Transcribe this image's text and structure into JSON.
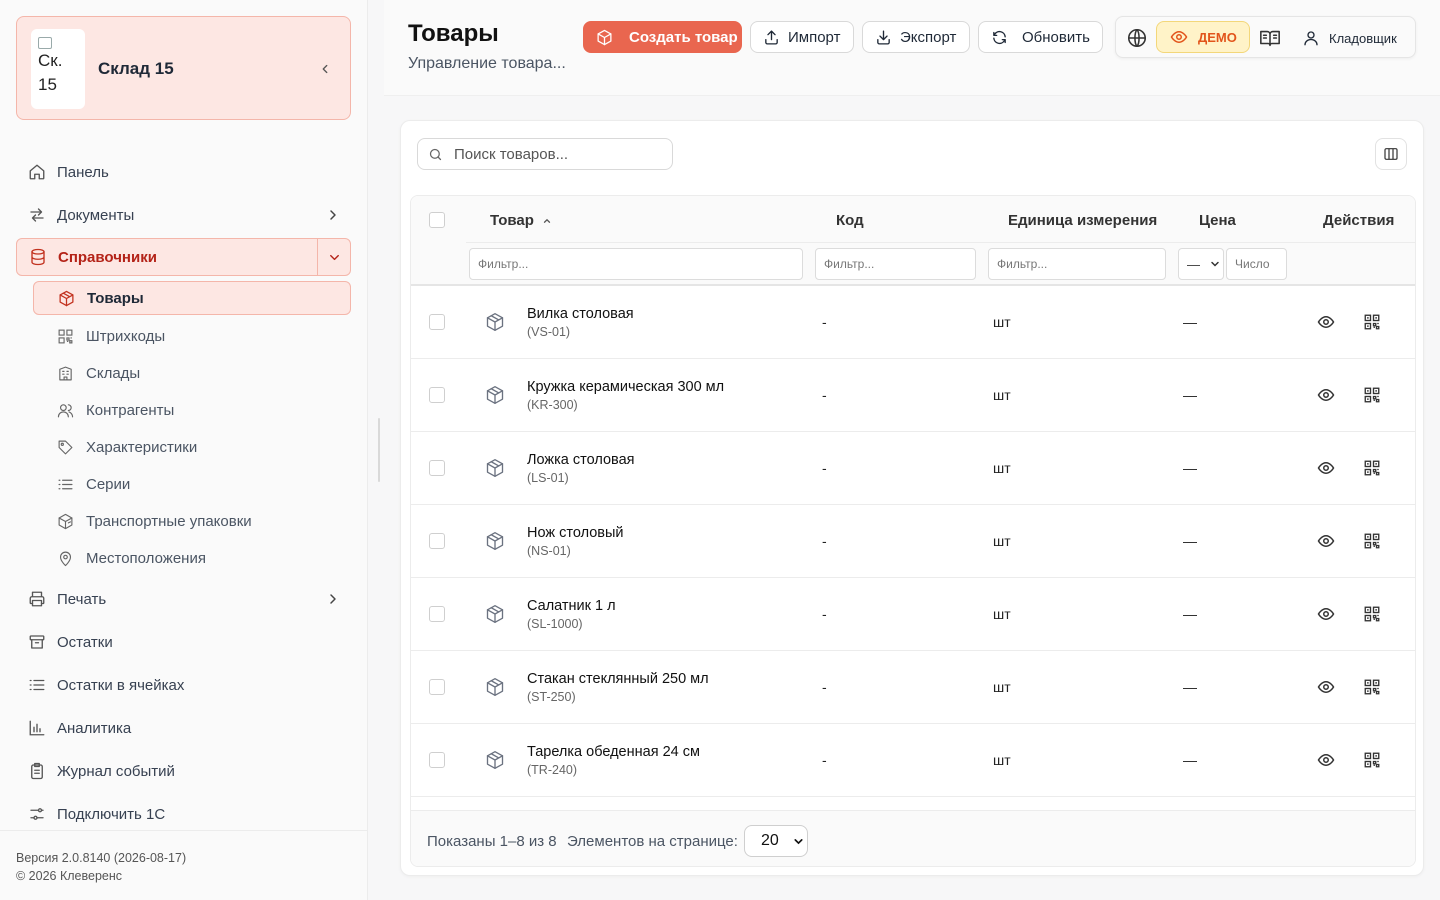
{
  "brand": {
    "logo_line1": "Ск.",
    "logo_line2": "15",
    "title": "Склад 15"
  },
  "nav": {
    "dashboard": "Панель",
    "documents": "Документы",
    "catalogs": "Справочники",
    "catalog_items": {
      "products": "Товары",
      "barcodes": "Штрихкоды",
      "warehouses": "Склады",
      "counterparties": "Контрагенты",
      "characteristics": "Характеристики",
      "series": "Серии",
      "transport_packs": "Транспортные упаковки",
      "locations": "Местоположения"
    },
    "print": "Печать",
    "stock": "Остатки",
    "cell_stock": "Остатки в ячейках",
    "analytics": "Аналитика",
    "event_log": "Журнал событий",
    "connect_1c": "Подключить 1С"
  },
  "footer": {
    "version": "Версия 2.0.8140 (2026-08-17)",
    "copyright": "© 2026 Клеверенс"
  },
  "header": {
    "title": "Товары",
    "subtitle": "Управление товара...",
    "create_label": "Создать товар",
    "import_label": "Импорт",
    "export_label": "Экспорт",
    "refresh_label": "Обновить",
    "demo_label": "ДЕМО",
    "user_label": "Кладовщик"
  },
  "search": {
    "placeholder": "Поиск товаров..."
  },
  "table": {
    "columns": {
      "product": "Товар",
      "code": "Код",
      "unit": "Единица измерения",
      "price": "Цена",
      "actions": "Действия"
    },
    "filters": {
      "product": "Фильтр...",
      "code": "Фильтр...",
      "unit": "Фильтр...",
      "price_op": "—",
      "price_num": "Число"
    },
    "rows": [
      {
        "name": "Вилка столовая",
        "sku": "(VS-01)",
        "code": "-",
        "unit": "шт",
        "price": "—"
      },
      {
        "name": "Кружка керамическая 300 мл",
        "sku": "(KR-300)",
        "code": "-",
        "unit": "шт",
        "price": "—"
      },
      {
        "name": "Ложка столовая",
        "sku": "(LS-01)",
        "code": "-",
        "unit": "шт",
        "price": "—"
      },
      {
        "name": "Нож столовый",
        "sku": "(NS-01)",
        "code": "-",
        "unit": "шт",
        "price": "—"
      },
      {
        "name": "Салатник 1 л",
        "sku": "(SL-1000)",
        "code": "-",
        "unit": "шт",
        "price": "—"
      },
      {
        "name": "Стакан стеклянный 250 мл",
        "sku": "(ST-250)",
        "code": "-",
        "unit": "шт",
        "price": "—"
      },
      {
        "name": "Тарелка обеденная 24 см",
        "sku": "(TR-240)",
        "code": "-",
        "unit": "шт",
        "price": "—"
      }
    ],
    "footer": {
      "shown": "Показаны 1–8 из 8",
      "per_page_label": "Элементов на странице:",
      "per_page_value": "20"
    }
  },
  "colors": {
    "accent": "#e9664f",
    "accent_soft": "#fde7e3",
    "accent_border": "#f4b6aa",
    "active_text": "#b42318",
    "demo_bg": "#fff3c8",
    "demo_text": "#e2541b"
  }
}
